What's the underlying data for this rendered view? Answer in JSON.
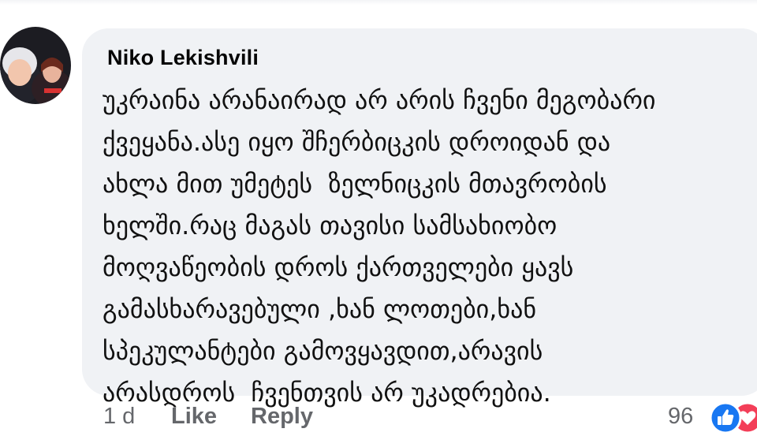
{
  "comment": {
    "author": "Niko Lekishvili",
    "text_lines": [
      "უკრაინა არანაირად არ არის ჩვენი მეგობარი",
      "ქვეყანა.ასე იყო შჩერბიცკის დროიდან და",
      "ახლა მით უმეტეს  ზელნიცკის მთავრობის",
      "ხელში.რაც მაგას თავისი სამსახიობო",
      "მოღვაწეობის დროს ქართველები ყავს",
      "გამასხარავებული ,ხან ლოთები,ხან",
      "სპეკულანტები გამოვყავდით,არავის",
      "არასდროს  ჩვენთვის არ უკადრებია."
    ],
    "time": "1 d",
    "like_label": "Like",
    "reply_label": "Reply",
    "reaction_count": "96",
    "reactions": [
      "like-reaction-icon",
      "love-reaction-icon"
    ]
  },
  "colors": {
    "bubble": "#f0f2f5",
    "meta_text": "#65676b",
    "like_blue": "#1877f2",
    "love_red": "#f33e58"
  }
}
